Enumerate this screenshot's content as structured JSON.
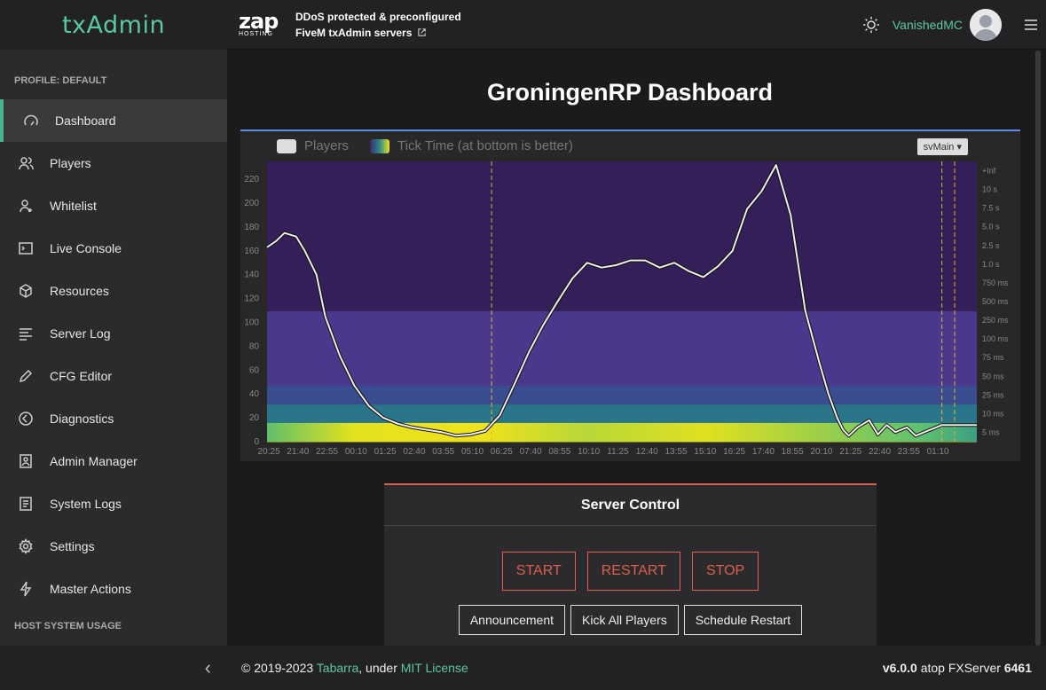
{
  "brand": "txAdmin",
  "sidebar": {
    "profile_label": "PROFILE: DEFAULT",
    "items": [
      {
        "label": "Dashboard",
        "icon": "gauge-icon"
      },
      {
        "label": "Players",
        "icon": "users-icon"
      },
      {
        "label": "Whitelist",
        "icon": "user-plus-icon"
      },
      {
        "label": "Live Console",
        "icon": "terminal-icon"
      },
      {
        "label": "Resources",
        "icon": "hexagon-icon"
      },
      {
        "label": "Server Log",
        "icon": "list-icon"
      },
      {
        "label": "CFG Editor",
        "icon": "pencil-icon"
      },
      {
        "label": "Diagnostics",
        "icon": "diagnostics-icon"
      },
      {
        "label": "Admin Manager",
        "icon": "admin-icon"
      },
      {
        "label": "System Logs",
        "icon": "document-icon"
      },
      {
        "label": "Settings",
        "icon": "gear-icon"
      },
      {
        "label": "Master Actions",
        "icon": "bolt-icon"
      }
    ],
    "active_index": 0,
    "host_label": "HOST SYSTEM USAGE",
    "collapse_glyph": "‹"
  },
  "header": {
    "zap_logo": "zap",
    "zap_sub": "HOSTING",
    "promo_line1": "DDoS protected & preconfigured",
    "promo_line2": "FiveM txAdmin servers",
    "username": "VanishedMC"
  },
  "main": {
    "title": "GroningenRP Dashboard"
  },
  "chart_data": {
    "type": "heatmap",
    "legend": [
      "Players",
      "Tick Time (at bottom is better)"
    ],
    "thread_select": "svMain",
    "x_ticks": [
      "20:25",
      "21:40",
      "22:55",
      "00:10",
      "01:25",
      "02:40",
      "03:55",
      "05:10",
      "06:25",
      "07:40",
      "08:55",
      "10:10",
      "11:25",
      "12:40",
      "13:55",
      "15:10",
      "16:25",
      "17:40",
      "18:55",
      "20:10",
      "21:25",
      "22:40",
      "23:55",
      "01:10"
    ],
    "y_left_ticks": [
      0,
      20,
      40,
      60,
      80,
      100,
      120,
      140,
      160,
      180,
      200,
      220
    ],
    "y_left_range": [
      0,
      235
    ],
    "y_right_ticks": [
      "5 ms",
      "10 ms",
      "25 ms",
      "50 ms",
      "75 ms",
      "100 ms",
      "250 ms",
      "500 ms",
      "750 ms",
      "1.0 s",
      "2.5 s",
      "5.0 s",
      "7.5 s",
      "10 s",
      "+Inf"
    ],
    "restart_markers_x": [
      7.72,
      23.2,
      23.64
    ],
    "players_series": {
      "name": "Players",
      "x": [
        0,
        0.3,
        0.6,
        1,
        1.3,
        1.7,
        2,
        2.5,
        3,
        3.5,
        4,
        4.5,
        5,
        5.5,
        6,
        6.5,
        7,
        7.5,
        8,
        8.5,
        9,
        9.5,
        10,
        10.5,
        11,
        11.5,
        12,
        12.5,
        13,
        13.5,
        14,
        14.5,
        15,
        15.5,
        16,
        16.5,
        17,
        17.5,
        18,
        18.5,
        19,
        19.3,
        19.6,
        19.8,
        20,
        20.3,
        20.7,
        21,
        21.3,
        21.6,
        22,
        22.3,
        22.6,
        22.8,
        23,
        23.2,
        23.3,
        23.5,
        23.7,
        23.9,
        24.1,
        24.4
      ],
      "y": [
        163,
        168,
        175,
        172,
        160,
        140,
        105,
        72,
        47,
        30,
        20,
        15,
        12,
        10,
        8,
        5,
        6,
        9,
        22,
        48,
        75,
        98,
        118,
        137,
        150,
        146,
        148,
        152,
        152,
        146,
        150,
        143,
        138,
        147,
        160,
        195,
        210,
        232,
        190,
        110,
        65,
        40,
        20,
        10,
        5,
        12,
        18,
        6,
        14,
        8,
        12,
        5,
        8,
        10,
        12,
        14,
        14,
        14,
        14,
        14,
        14,
        14
      ]
    }
  },
  "control": {
    "title": "Server Control",
    "start": "START",
    "restart": "RESTART",
    "stop": "STOP",
    "announcement": "Announcement",
    "kick_all": "Kick All Players",
    "schedule_restart": "Schedule Restart"
  },
  "footer": {
    "copyright": "© 2019-2023",
    "author": "Tabarra",
    "under": ", under",
    "license": "MIT License",
    "version": "v6.0.0",
    "atop": "atop FXServer",
    "build": "6461"
  },
  "colors": {
    "accent": "#5ac8a0",
    "danger": "#d9604f",
    "chart_border": "#5a8ee8"
  }
}
